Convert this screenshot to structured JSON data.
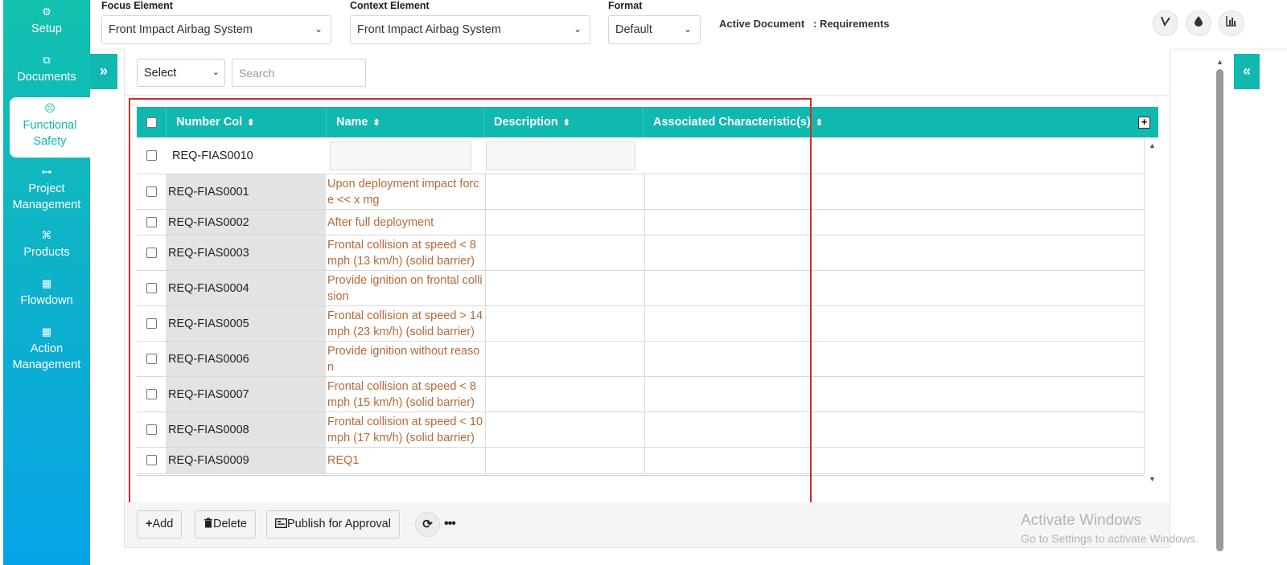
{
  "sidebar": {
    "items": [
      {
        "label": "Setup",
        "icon": "⚙"
      },
      {
        "label": "Documents",
        "icon": "⧉"
      },
      {
        "label": "Functional Safety",
        "icon": "☹"
      },
      {
        "label": "Project Management",
        "icon": "⊶"
      },
      {
        "label": "Products",
        "icon": "⌘"
      },
      {
        "label": "Flowdown",
        "icon": "▦"
      },
      {
        "label": "Action Management",
        "icon": "▦"
      }
    ]
  },
  "topbar": {
    "focus_label": "Focus Element",
    "focus_value": "Front Impact Airbag System",
    "context_label": "Context Element",
    "context_value": "Front Impact Airbag System",
    "format_label": "Format",
    "format_value": "Default",
    "active_doc_label": "Active Document",
    "active_doc_value": ": Requirements",
    "chevron": "⌄"
  },
  "toggles": {
    "expand": "»",
    "collapse": "«"
  },
  "filter": {
    "select_value": "Select",
    "search_placeholder": "Search"
  },
  "grid": {
    "columns": [
      "Number Col",
      "Name",
      "Description",
      "Associated Characteristic(s)"
    ],
    "sort_glyph": "⬍",
    "expand_glyph": "+",
    "new_row_number": "REQ-FIAS0010",
    "rows": [
      {
        "number": "REQ-FIAS0001",
        "name": "Upon deployment impact force << x mg"
      },
      {
        "number": "REQ-FIAS0002",
        "name": "After full deployment"
      },
      {
        "number": "REQ-FIAS0003",
        "name": "Frontal collision at speed < 8 mph (13 km/h) (solid barrier)"
      },
      {
        "number": "REQ-FIAS0004",
        "name": "Provide ignition on frontal collision"
      },
      {
        "number": "REQ-FIAS0005",
        "name": "Frontal collision at speed > 14 mph (23 km/h) (solid barrier)"
      },
      {
        "number": "REQ-FIAS0006",
        "name": "Provide ignition without reason"
      },
      {
        "number": "REQ-FIAS0007",
        "name": "Frontal collision at speed < 8 mph (15 km/h) (solid barrier)"
      },
      {
        "number": "REQ-FIAS0008",
        "name": "Frontal collision at speed < 10 mph (17 km/h) (solid barrier)"
      },
      {
        "number": "REQ-FIAS0009",
        "name": "REQ1"
      }
    ]
  },
  "footer": {
    "add": "Add",
    "delete": "Delete",
    "publish": "Publish for Approval",
    "refresh": "⟳",
    "more": "•••"
  },
  "watermark": {
    "line1": "Activate Windows",
    "line2": "Go to Settings to activate Windows."
  }
}
